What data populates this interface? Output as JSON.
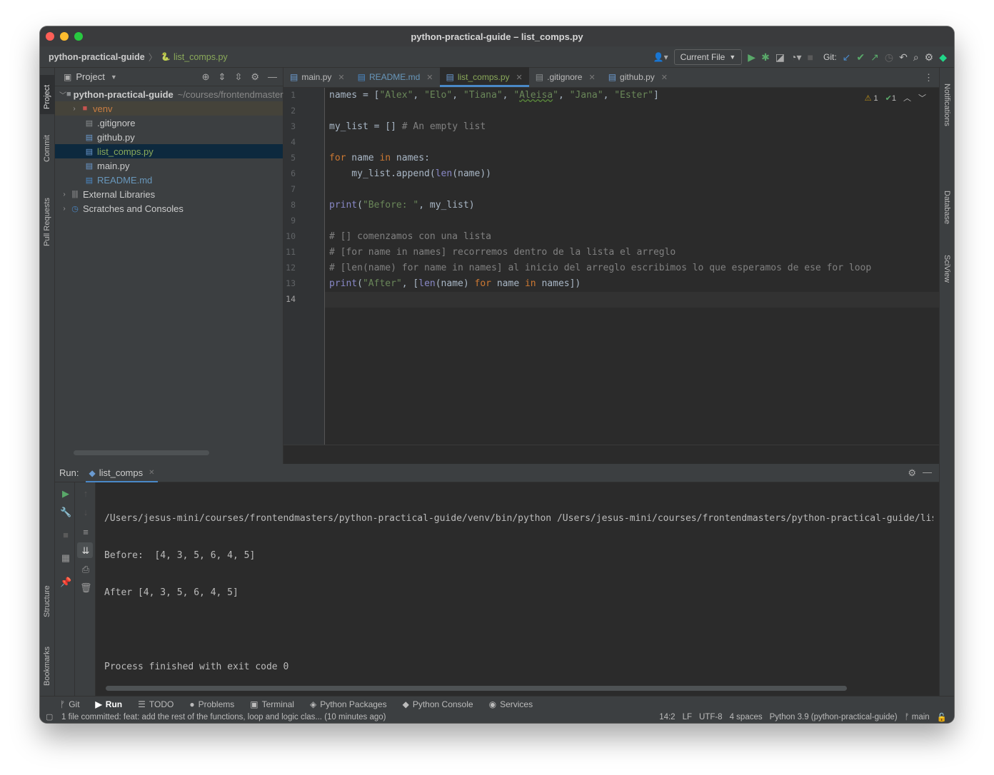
{
  "window": {
    "title": "python-practical-guide – list_comps.py"
  },
  "toolbar": {
    "project": "python-practical-guide",
    "file": "list_comps.py",
    "run_config": "Current File",
    "git_label": "Git:"
  },
  "left_strip": {
    "project": "Project",
    "commit": "Commit",
    "pull_requests": "Pull Requests",
    "structure": "Structure",
    "bookmarks": "Bookmarks"
  },
  "right_strip": {
    "notifications": "Notifications",
    "database": "Database",
    "sciview": "SciView"
  },
  "project_panel": {
    "header": "Project",
    "root": "python-practical-guide",
    "root_path": "~/courses/frontendmasters/python-practical-guide",
    "items": [
      {
        "label": "venv"
      },
      {
        "label": ".gitignore"
      },
      {
        "label": "github.py"
      },
      {
        "label": "list_comps.py"
      },
      {
        "label": "main.py"
      },
      {
        "label": "README.md"
      },
      {
        "label": "External Libraries"
      },
      {
        "label": "Scratches and Consoles"
      }
    ]
  },
  "editor": {
    "tabs": [
      {
        "label": "main.py"
      },
      {
        "label": "README.md"
      },
      {
        "label": "list_comps.py"
      },
      {
        "label": ".gitignore"
      },
      {
        "label": "github.py"
      }
    ],
    "warnings": "1",
    "oks": "1",
    "line_numbers": [
      "1",
      "2",
      "3",
      "4",
      "5",
      "6",
      "7",
      "8",
      "9",
      "10",
      "11",
      "12",
      "13",
      "14"
    ],
    "cursor_line": 14
  },
  "run_panel": {
    "label": "Run:",
    "tab": "list_comps",
    "output": [
      "/Users/jesus-mini/courses/frontendmasters/python-practical-guide/venv/bin/python /Users/jesus-mini/courses/frontendmasters/python-practical-guide/list_comps.py",
      "Before:  [4, 3, 5, 6, 4, 5]",
      "After [4, 3, 5, 6, 4, 5]",
      "",
      "Process finished with exit code 0"
    ]
  },
  "bottom_tabs": [
    "Git",
    "Run",
    "TODO",
    "Problems",
    "Terminal",
    "Python Packages",
    "Python Console",
    "Services"
  ],
  "status_bar": {
    "message": "1 file committed: feat: add the rest of the functions, loop and logic clas... (10 minutes ago)",
    "position": "14:2",
    "line_sep": "LF",
    "encoding": "UTF-8",
    "indent": "4 spaces",
    "interpreter": "Python 3.9 (python-practical-guide)",
    "branch": "main"
  },
  "colors": {
    "keyword": "#cc7832",
    "string": "#6a8759",
    "builtin": "#8888c6",
    "comment": "#808080",
    "accent": "#4a88c7"
  }
}
